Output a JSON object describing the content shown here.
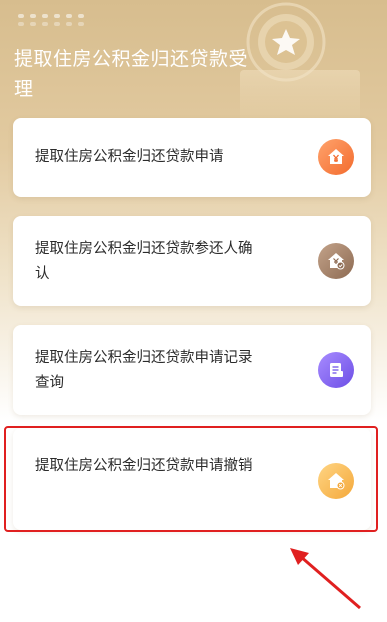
{
  "header": {
    "title": "提取住房公积金归还贷款受理"
  },
  "cards": [
    {
      "label": "提取住房公积金归还贷款申请",
      "icon": "house-yuan-icon",
      "color": "#f36b2e"
    },
    {
      "label": "提取住房公积金归还贷款参还人确认",
      "icon": "house-check-icon",
      "color": "#8d6a52"
    },
    {
      "label": "提取住房公积金归还贷款申请记录查询",
      "icon": "document-list-icon",
      "color": "#6c4ee6"
    },
    {
      "label": "提取住房公积金归还贷款申请撤销",
      "icon": "house-cancel-icon",
      "color": "#f4a83a"
    }
  ],
  "annotation": {
    "highlight_color": "#e02020",
    "highlighted_card": "提取住房公积金归还贷款申请撤销"
  }
}
